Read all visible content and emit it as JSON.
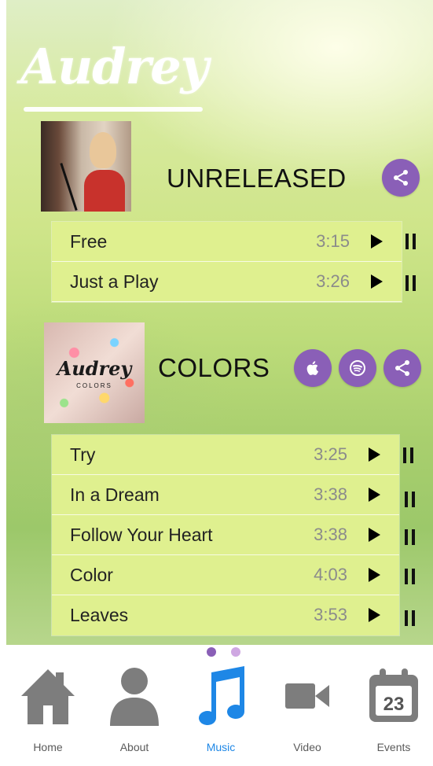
{
  "artist": {
    "logo_text": "Audrey"
  },
  "albums": [
    {
      "title": "UNRELEASED",
      "tracks": [
        {
          "name": "Free",
          "duration": "3:15"
        },
        {
          "name": "Just a Play",
          "duration": "3:26"
        }
      ]
    },
    {
      "title": "COLORS",
      "cover_text": "Audrey",
      "cover_subtext": "COLORS",
      "tracks": [
        {
          "name": "Try",
          "duration": "3:25"
        },
        {
          "name": "In a Dream",
          "duration": "3:38"
        },
        {
          "name": "Follow Your Heart",
          "duration": "3:38"
        },
        {
          "name": "Color",
          "duration": "4:03"
        },
        {
          "name": "Leaves",
          "duration": "3:53"
        }
      ]
    }
  ],
  "colors": {
    "accent_purple": "#8a5fb7",
    "active_tab": "#1e87e6",
    "track_bg": "#dff08f"
  },
  "tabs": [
    {
      "label": "Home",
      "icon": "home-icon"
    },
    {
      "label": "About",
      "icon": "person-icon"
    },
    {
      "label": "Music",
      "icon": "music-note-icon"
    },
    {
      "label": "Video",
      "icon": "video-camera-icon"
    },
    {
      "label": "Events",
      "icon": "calendar-icon",
      "calendar_day": "23"
    }
  ],
  "page_indicator": {
    "count": 2,
    "active": 1
  }
}
